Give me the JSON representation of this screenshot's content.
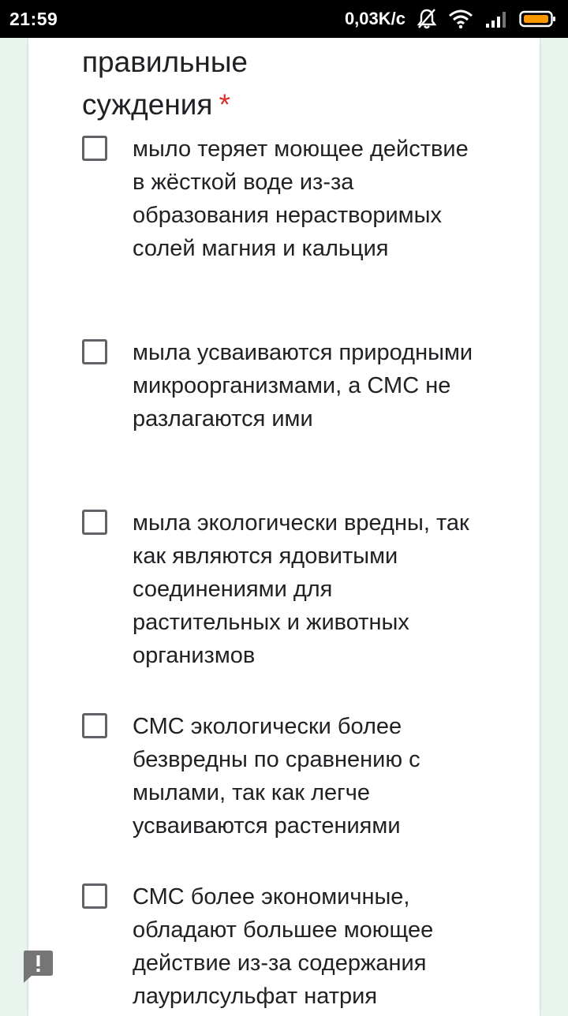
{
  "status_bar": {
    "time": "21:59",
    "speed": "0,03K/c",
    "battery_color": "#ff9800"
  },
  "question": {
    "title_line_1": "правильные",
    "title_line_2": "суждения",
    "required_mark": "*"
  },
  "options": [
    {
      "text": "мыло теряет моющее действие в жёсткой воде из-за образования нерастворимых солей магния и кальция",
      "checked": false
    },
    {
      "text": "мыла усваиваются природными микроорганизмами, а СМС не разлагаются ими",
      "checked": false
    },
    {
      "text": "мыла экологически вредны, так как являются ядовитыми соединениями для растительных и животных организмов",
      "checked": false
    },
    {
      "text": "СМС экологически более безвредны по сравнению с мылами, так как легче усваиваются растениями",
      "checked": false
    },
    {
      "text": "СМС более экономичные, обладают большее моющее действие из-за содержания лаурилсульфат натрия",
      "checked": false
    }
  ],
  "icons": {
    "feedback": "feedback-exclamation-icon",
    "notifications_off": "bell-off-icon",
    "wifi": "wifi-icon",
    "signal": "signal-icon",
    "battery": "battery-icon"
  }
}
